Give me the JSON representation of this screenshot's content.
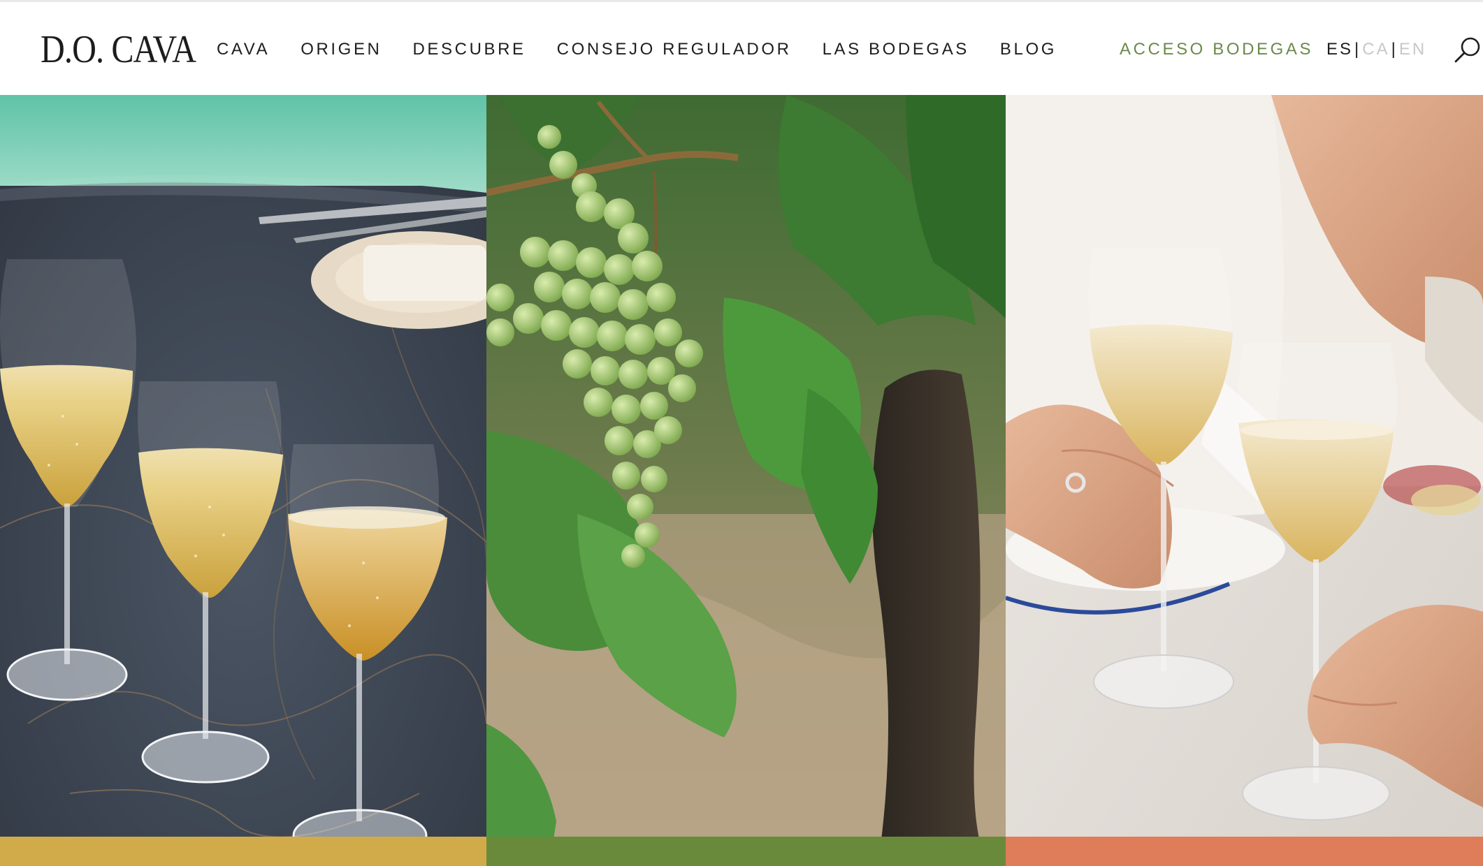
{
  "header": {
    "logo": "D.O. CAVA",
    "nav": [
      {
        "label": "CAVA"
      },
      {
        "label": "ORIGEN"
      },
      {
        "label": "DESCUBRE"
      },
      {
        "label": "CONSEJO REGULADOR"
      },
      {
        "label": "LAS BODEGAS"
      },
      {
        "label": "BLOG"
      }
    ],
    "access_label": "ACCESO BODEGAS",
    "languages": [
      {
        "code": "ES",
        "active": true
      },
      {
        "code": "CA",
        "active": false
      },
      {
        "code": "EN",
        "active": false
      }
    ],
    "language_separator": "|",
    "search_icon": "search-icon",
    "accent_color": "#6b8a4a"
  },
  "panels": [
    {
      "image": "three-cava-glasses-on-stone-table",
      "band_color": "#d1ab4a"
    },
    {
      "image": "green-grape-bunch-on-vine",
      "band_color": "#6a8a3b"
    },
    {
      "image": "hands-toasting-cava-glasses",
      "band_color": "#df7d5a"
    }
  ]
}
